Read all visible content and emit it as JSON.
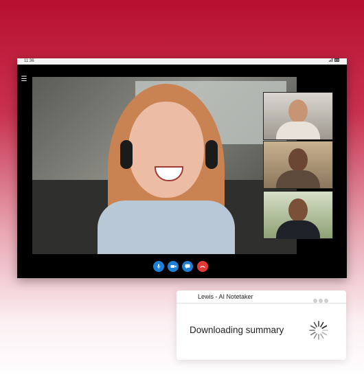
{
  "status_bar": {
    "time": "11:36",
    "icons": "signal battery"
  },
  "controls": [
    {
      "name": "mic-button",
      "icon": "microphone-icon"
    },
    {
      "name": "camera-button",
      "icon": "video-camera-icon"
    },
    {
      "name": "chat-button",
      "icon": "chat-bubble-icon"
    },
    {
      "name": "end-call-button",
      "icon": "phone-hangup-icon"
    }
  ],
  "notetaker": {
    "title": "Lewis - AI Notetaker",
    "message": "Downloading summary"
  },
  "colors": {
    "accent": "#1e7fd6",
    "end_call": "#e53935",
    "background_top": "#b8102f"
  }
}
